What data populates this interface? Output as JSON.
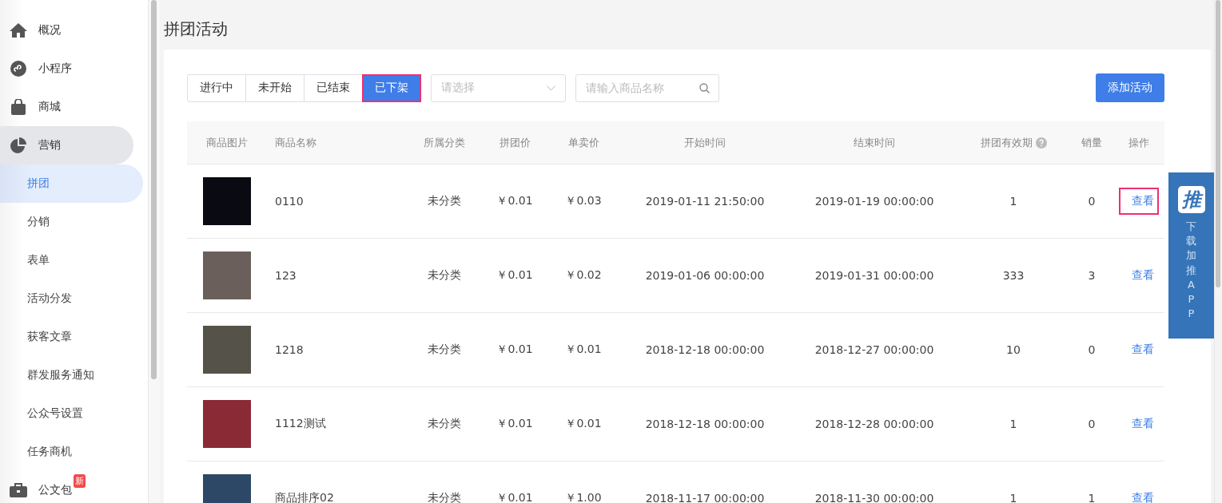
{
  "sidebar": {
    "items": [
      {
        "label": "概况",
        "kind": "home",
        "selected": false
      },
      {
        "label": "小程序",
        "kind": "miniapp",
        "selected": false
      },
      {
        "label": "商城",
        "kind": "shop",
        "selected": false
      },
      {
        "label": "营销",
        "kind": "marketing",
        "selected": false,
        "expanded": true,
        "children": [
          {
            "label": "拼团",
            "selected": true
          },
          {
            "label": "分销",
            "selected": false
          },
          {
            "label": "表单",
            "selected": false
          },
          {
            "label": "活动分发",
            "selected": false
          },
          {
            "label": "获客文章",
            "selected": false
          },
          {
            "label": "群发服务通知",
            "selected": false
          },
          {
            "label": "公众号设置",
            "selected": false
          },
          {
            "label": "任务商机",
            "selected": false
          }
        ]
      },
      {
        "label": "公文包",
        "kind": "briefcase",
        "selected": false,
        "badge": "新"
      }
    ]
  },
  "page_title": "拼团活动",
  "tabs": [
    {
      "label": "进行中",
      "selected": false,
      "highlighted": false
    },
    {
      "label": "未开始",
      "selected": false,
      "highlighted": false
    },
    {
      "label": "已结束",
      "selected": false,
      "highlighted": false
    },
    {
      "label": "已下架",
      "selected": true,
      "highlighted": true
    }
  ],
  "category_select": {
    "placeholder": "请选择"
  },
  "search": {
    "placeholder": "请输入商品名称"
  },
  "add_button": "添加活动",
  "table": {
    "columns": [
      "商品图片",
      "商品名称",
      "所属分类",
      "拼团价",
      "单卖价",
      "开始时间",
      "结束时间",
      "拼团有效期",
      "销量",
      "操作"
    ],
    "rows": [
      {
        "name": "0110",
        "category": "未分类",
        "group_price": "￥0.01",
        "single_price": "￥0.03",
        "start": "2019-01-11 21:50:00",
        "end": "2019-01-19 00:00:00",
        "validity": "1",
        "sales": "0",
        "action": "查看",
        "highlighted": true
      },
      {
        "name": "123",
        "category": "未分类",
        "group_price": "￥0.01",
        "single_price": "￥0.02",
        "start": "2019-01-06 00:00:00",
        "end": "2019-01-31 00:00:00",
        "validity": "333",
        "sales": "3",
        "action": "查看",
        "highlighted": false
      },
      {
        "name": "1218",
        "category": "未分类",
        "group_price": "￥0.01",
        "single_price": "￥0.01",
        "start": "2018-12-18 00:00:00",
        "end": "2018-12-27 00:00:00",
        "validity": "10",
        "sales": "0",
        "action": "查看",
        "highlighted": false
      },
      {
        "name": "1112测试",
        "category": "未分类",
        "group_price": "￥0.01",
        "single_price": "￥0.01",
        "start": "2018-12-18 00:00:00",
        "end": "2018-12-28 00:00:00",
        "validity": "1",
        "sales": "0",
        "action": "查看",
        "highlighted": false
      },
      {
        "name": "商品排序02",
        "category": "未分类",
        "group_price": "￥0.01",
        "single_price": "￥1.00",
        "start": "2018-11-17 00:00:00",
        "end": "2018-11-30 00:00:00",
        "validity": "1",
        "sales": "1",
        "action": "查看",
        "highlighted": false
      }
    ]
  },
  "app_promo": {
    "logo": "推",
    "label": "下载加推APP"
  }
}
